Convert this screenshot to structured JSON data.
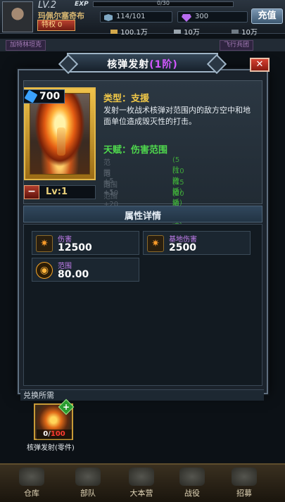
{
  "hud": {
    "level": "LV.2",
    "exp_label": "EXP",
    "exp_value": "0/30",
    "player_name": "玛佩尔塞奇布",
    "privilege_label": "特权",
    "privilege_level": "0",
    "energy": "114/101",
    "gems": "300",
    "recharge": "充值",
    "resources": [
      "100.1万",
      "10万",
      "10万"
    ],
    "behind_tabs": [
      "加特林坦克",
      "飞行兵团"
    ]
  },
  "modal": {
    "title": "核弹发射",
    "tier": "(1阶)",
    "close_icon": "close-icon",
    "card": {
      "cost": "700",
      "level": "Lv:1",
      "level_badge": "−"
    },
    "type_label": "类型：支援",
    "description": "发射一枚战术核弹对范围内的敌方空中和地面单位造成毁灭性的打击。",
    "talent_label": "天赋：伤害范围",
    "talents": [
      {
        "name": "范围+5",
        "condition": "(5阶激活)"
      },
      {
        "name": "范围+5",
        "condition": "(10阶激活)"
      },
      {
        "name": "范围+10",
        "condition": "(15阶激活)"
      },
      {
        "name": "范围+20",
        "condition": "(20阶激活)"
      }
    ],
    "attributes_title": "属性详情",
    "stats": [
      {
        "label": "伤害",
        "value": "12500",
        "icon": "damage-icon"
      },
      {
        "label": "基地伤害",
        "value": "2500",
        "icon": "base-damage-icon"
      },
      {
        "label": "范围",
        "value": "80.00",
        "icon": "range-icon"
      }
    ],
    "exchange_label": "兑换所需",
    "part": {
      "have": "0",
      "need": "100",
      "name": "核弹发射(零件)"
    }
  },
  "nav": [
    "仓库",
    "部队",
    "大本营",
    "战役",
    "招募"
  ],
  "colors": {
    "accent_gold": "#f2c948",
    "talent_green": "#4fd84d",
    "tier_purple": "#d357ff",
    "stat_label_purple": "#c57ff0"
  }
}
